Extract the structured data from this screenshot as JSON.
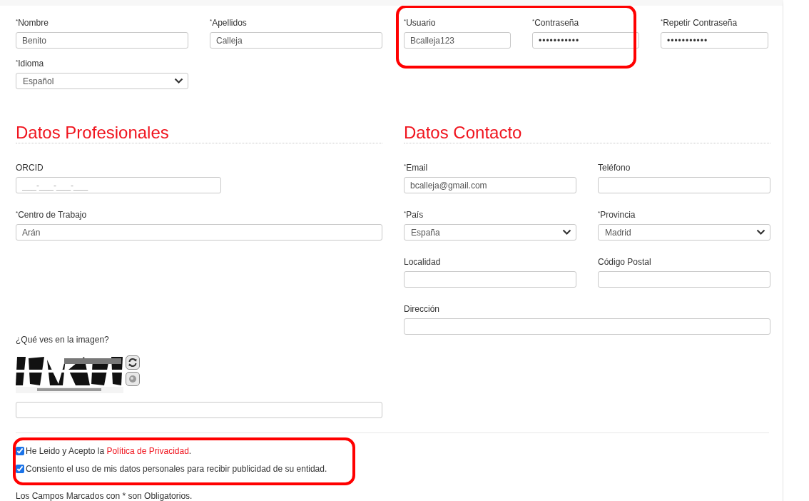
{
  "account": {
    "name_fields": [
      {
        "kind": "text",
        "label": "$^{*}$Nombre",
        "value": "Benito"
      },
      {
        "kind": "text",
        "label": "$^{*}$Apellidos",
        "value": "Calleja"
      }
    ],
    "credentials": {
      "highlighted": true,
      "fields": [
        {
          "kind": "text",
          "label": "$^{*}$Usuario",
          "value": "Bcalleja123"
        },
        {
          "kind": "password",
          "label": "$^{*}$Contraseña",
          "value": "•••••••••••"
        }
      ]
    },
    "repeat_password": {
      "kind": "password",
      "label": "$^{*}$Repetir Contraseña",
      "value": "•••••••••••"
    },
    "language": {
      "kind": "select",
      "label": "$^{*}$Idioma",
      "value": "Español"
    }
  },
  "professional": {
    "title": "Datos Profesionales",
    "fields": [
      {
        "kind": "text",
        "label": "ORCID",
        "placeholder": "___-___-___-___",
        "half": true
      },
      {
        "kind": "text",
        "label": "$^{*}$Centro de Trabajo",
        "value": "Arán"
      }
    ]
  },
  "contact": {
    "title": "Datos Contacto",
    "fields": [
      {
        "kind": "text",
        "label": "$^{*}$Email",
        "value": "bcalleja@gmail.com"
      },
      {
        "kind": "text",
        "label": "Teléfono"
      },
      {
        "kind": "select",
        "label": "$^{*}$País",
        "value": "España"
      },
      {
        "kind": "select",
        "label": "$^{*}$Provincia",
        "value": "Madrid"
      },
      {
        "kind": "text",
        "label": "Localidad"
      },
      {
        "kind": "text",
        "label": "Código Postal"
      },
      {
        "kind": "text",
        "label": "Dirección",
        "wide": true
      }
    ]
  },
  "captcha": {
    "question": "¿Qué ves en la imagen?"
  },
  "consent": {
    "highlighted": true,
    "items": [
      {
        "text": "He Leido y Acepto la ",
        "link": "Política de Privacidad",
        "after": ".",
        "checked": true
      },
      {
        "text": "Consiento el uso de mis datos personales para recibir publicidad de su entidad.",
        "checked": true
      }
    ]
  },
  "footer_note": "Los Campos Marcados con * son Obligatorios."
}
